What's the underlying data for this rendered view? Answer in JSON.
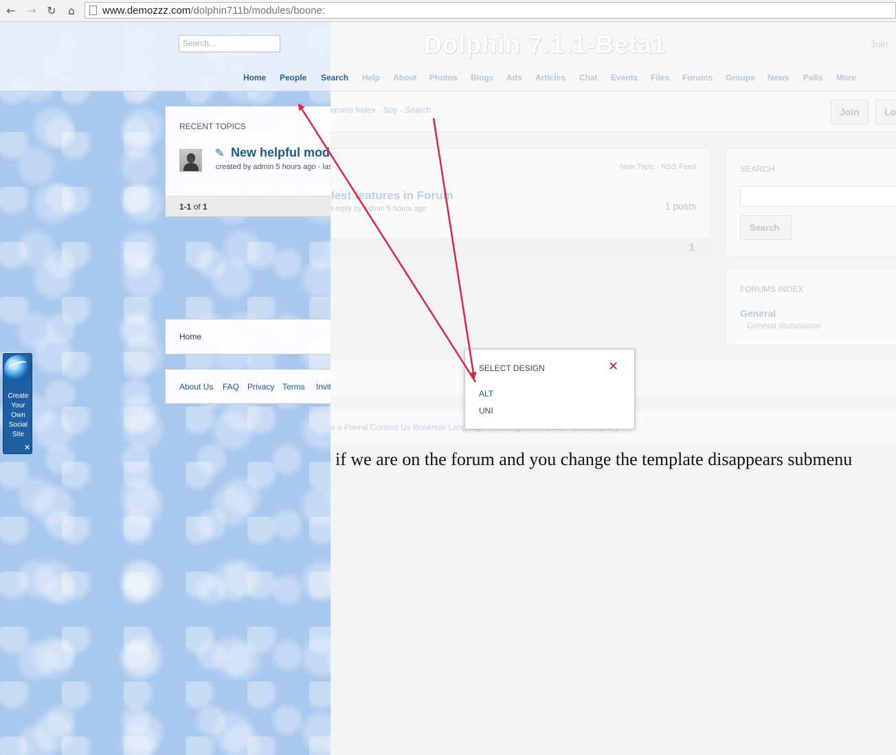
{
  "browser": {
    "url_host": "www.demozzz.com",
    "url_path": "/dolphin711b/modules/boone:"
  },
  "site": {
    "brand": "Dolphin 7.1.1-Beta1",
    "join_link": "Join",
    "search_placeholder": "Search..."
  },
  "menu": {
    "items": [
      {
        "label": "Home"
      },
      {
        "label": "People"
      },
      {
        "label": "Search"
      },
      {
        "label": "Help"
      },
      {
        "label": "About"
      },
      {
        "label": "Photos"
      },
      {
        "label": "Blogs"
      },
      {
        "label": "Ads"
      },
      {
        "label": "Articles"
      },
      {
        "label": "Chat"
      },
      {
        "label": "Events"
      },
      {
        "label": "Files"
      },
      {
        "label": "Forums"
      },
      {
        "label": "Groups"
      },
      {
        "label": "News"
      },
      {
        "label": "Polls"
      },
      {
        "label": "More"
      }
    ]
  },
  "submenu": {
    "breadcrumb": "orums Index · Spy · Search",
    "join_button": "Join",
    "login_button": "Lo"
  },
  "recent_topics": {
    "title": "RECENT TOPICS",
    "topic_title": "New helpful mod",
    "topic_sub": "created by admin 5 hours ago · las",
    "pagination": {
      "range": "1-1",
      "of": "of",
      "total": "1"
    }
  },
  "faded_topic": {
    "links": "New Topic · RSS Feed",
    "title": "lest features in Forum",
    "sub": "t reply by admin 5 hours ago",
    "posts": "1 posts",
    "page": "1"
  },
  "search_box": {
    "title": "SEARCH",
    "button": "Search"
  },
  "forums_index": {
    "title": "FORUMS INDEX",
    "forum_name": "General",
    "forum_desc": "General discussions"
  },
  "left_boxes": {
    "home": "Home",
    "footer_links": [
      {
        "label": "About Us"
      },
      {
        "label": "FAQ"
      },
      {
        "label": "Privacy"
      },
      {
        "label": "Terms"
      },
      {
        "label": "Invit"
      }
    ]
  },
  "faded_footer": "e a Friend    Contact Us    Bookmar    Language: ...    Design: ...    © 2013 YourCompany",
  "widget": {
    "text": "Create\nYour\nOwn\nSocial\nSite",
    "close": "✕"
  },
  "popup": {
    "title": "SELECT DESIGN",
    "close": "✕",
    "options": [
      {
        "label": "ALT"
      },
      {
        "label": "UNI"
      }
    ]
  },
  "annotation": "if we are on the forum and you change the template disappears submenu",
  "colors": {
    "accent": "#1d5b8c",
    "arrow": "#e0243f",
    "close_red": "#cc1d1d"
  }
}
